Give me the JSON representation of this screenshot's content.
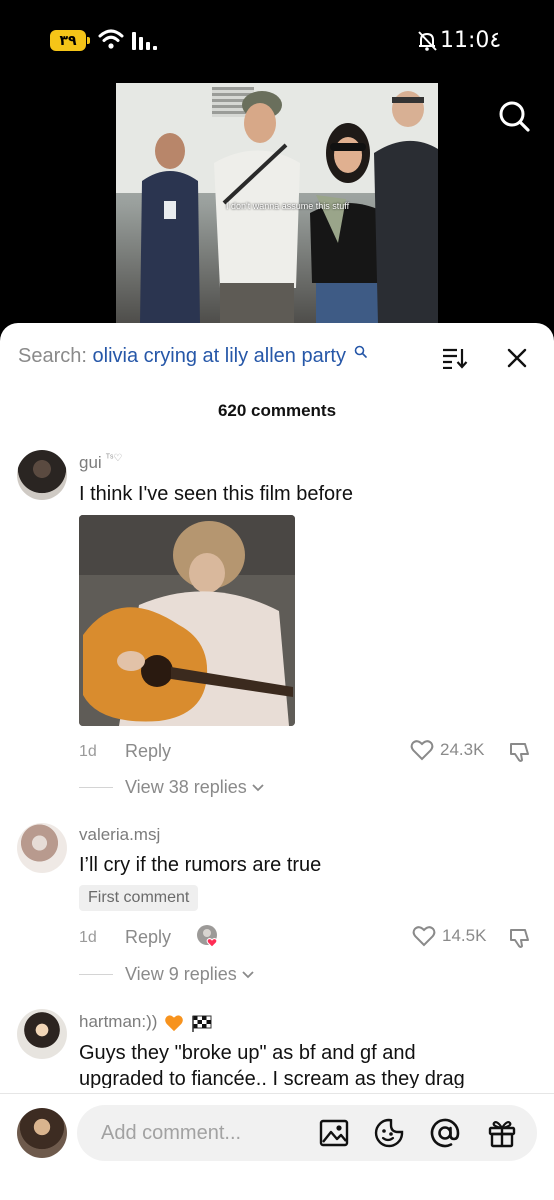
{
  "status_bar": {
    "battery": "٣٩",
    "time": "11:0٤"
  },
  "video": {
    "caption": "I don't wanna assume this stuff"
  },
  "comments_panel": {
    "search_label": "Search:",
    "search_query": "olivia crying at lily allen party",
    "count_text": "620 comments",
    "comments": [
      {
        "username": "gui",
        "username_tags": "ᵀˢ♡",
        "text": "I think I've seen this film before",
        "time": "1d",
        "reply_label": "Reply",
        "likes": "24.3K",
        "view_replies": "View 38 replies"
      },
      {
        "username": "valeria.msj",
        "text": "I’ll cry if the rumors are true",
        "badge": "First comment",
        "time": "1d",
        "reply_label": "Reply",
        "likes": "14.5K",
        "view_replies": "View 9 replies"
      },
      {
        "username": "hartman:))",
        "text_line1": "Guys they \"broke up\" as bf and gf and",
        "text_line2": "upgraded to fiancée.. I scream as they drag"
      }
    ]
  },
  "composer": {
    "placeholder": "Add comment..."
  }
}
